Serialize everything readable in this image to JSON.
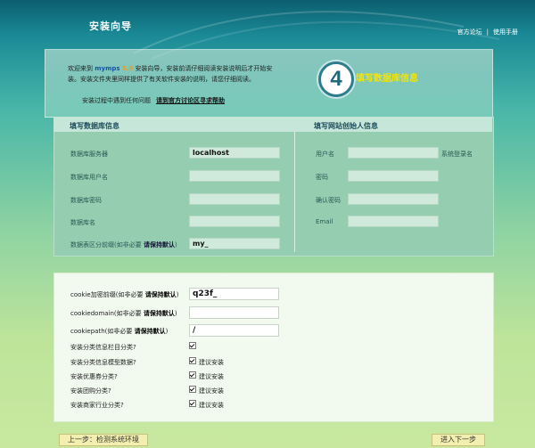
{
  "header": {
    "title": "安装向导",
    "links": [
      "官方论坛",
      "使用手册"
    ],
    "separator": "|"
  },
  "intro": {
    "line_prefix": "欢迎来到",
    "brand": "mymps",
    "version": "5.6",
    "line_suffix": "安装向导，安装前请仔细阅读安装说明后才开始安装。安装文件夹里同样提供了有关软件安装的说明，请您仔细阅读。",
    "help_text": "安装过程中遇到任何问题",
    "help_link": "请到官方讨论区寻求帮助"
  },
  "step": {
    "number": "4",
    "title": "填写数据库信息"
  },
  "db_section": {
    "title": "填写数据库信息",
    "fields": [
      {
        "label": "数据库服务器",
        "value": "localhost"
      },
      {
        "label": "数据库用户名",
        "value": ""
      },
      {
        "label": "数据库密码",
        "value": ""
      },
      {
        "label": "数据库名",
        "value": ""
      }
    ],
    "prefix_label": "数据表区分前缀(如非必要",
    "prefix_bold": "请保持默认",
    "prefix_close": ")",
    "prefix_value": "my_"
  },
  "admin_section": {
    "title": "填写网站创始人信息",
    "fields": [
      {
        "label": "用户名",
        "value": ""
      },
      {
        "label": "密码",
        "value": ""
      },
      {
        "label": "确认密码",
        "value": ""
      },
      {
        "label": "Email",
        "value": ""
      }
    ],
    "username_hint": "系统登录名"
  },
  "cookie_section": {
    "fields": [
      {
        "label": "cookie加密前缀(如非必要",
        "bold": "请保持默认",
        "close": ")",
        "value": "q23f_"
      },
      {
        "label": "cookiedomain(如非必要",
        "bold": "请保持默认",
        "close": ")",
        "value": ""
      },
      {
        "label": "cookiepath(如非必要",
        "bold": "请保持默认",
        "close": ")",
        "value": "/"
      }
    ]
  },
  "options": [
    {
      "label": "安装分类信息栏目分类?",
      "checked": true,
      "note": ""
    },
    {
      "label": "安装分类信息模型数据?",
      "checked": true,
      "note": "建议安装"
    },
    {
      "label": "安装优惠券分类?",
      "checked": true,
      "note": "建议安装"
    },
    {
      "label": "安装团购分类?",
      "checked": true,
      "note": "建议安装"
    },
    {
      "label": "安装商家行业分类?",
      "checked": true,
      "note": "建议安装"
    }
  ],
  "buttons": {
    "prev": "上一步：检测系统环境",
    "next": "进入下一步"
  }
}
